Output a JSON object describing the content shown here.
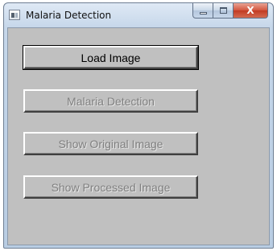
{
  "window": {
    "title": "Malaria Detection",
    "icon": "app-window-icon",
    "caption_buttons": {
      "minimize": "minimize-icon",
      "maximize": "maximize-icon",
      "close": "X"
    }
  },
  "buttons": {
    "load_image": "Load Image",
    "malaria_detection": "Malaria Detection",
    "show_original": "Show Original Image",
    "show_processed": "Show Processed Image"
  },
  "state": {
    "load_image_enabled": true,
    "malaria_detection_enabled": false,
    "show_original_enabled": false,
    "show_processed_enabled": false
  },
  "colors": {
    "client_background": "#c0c0c0",
    "disabled_text": "#808080",
    "close_button": "#c13a22"
  }
}
